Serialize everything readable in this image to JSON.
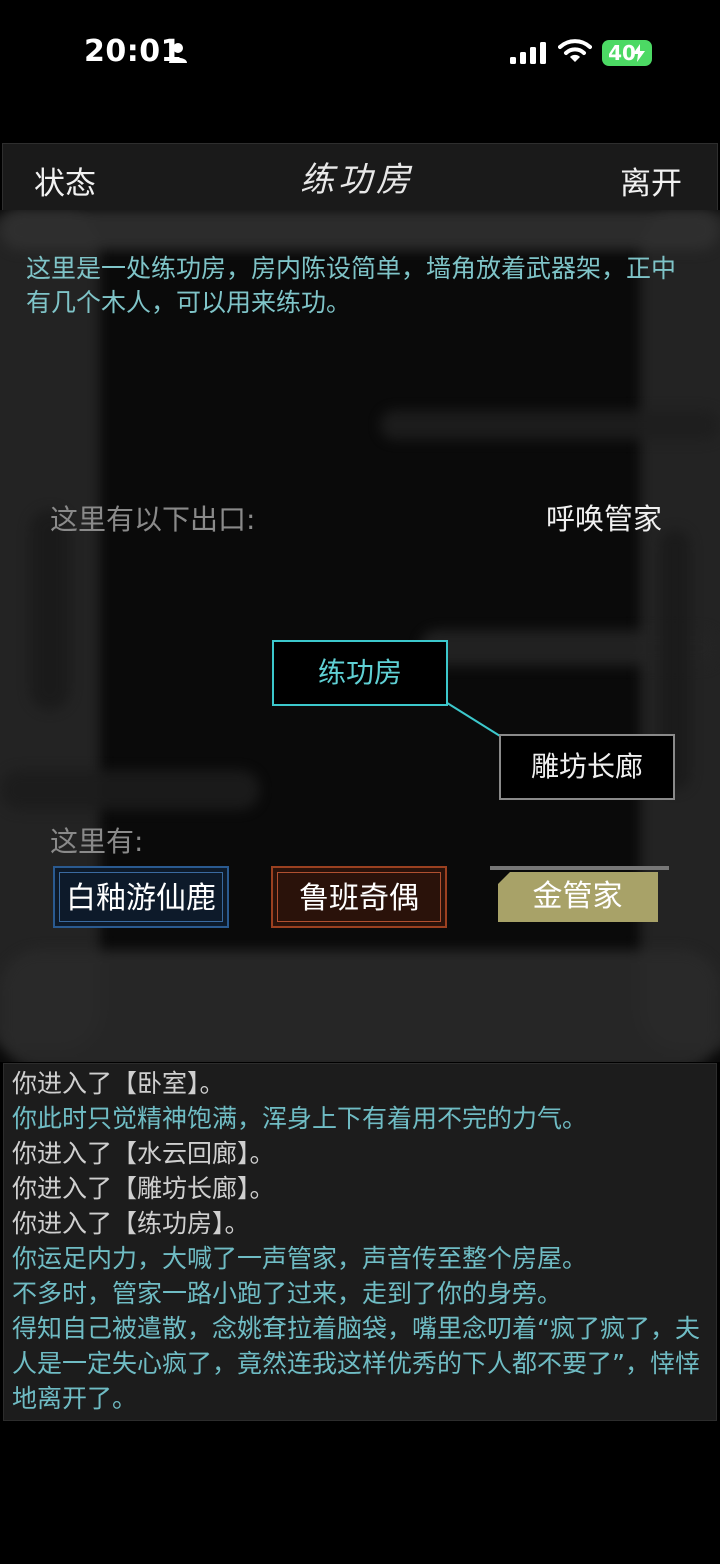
{
  "status_bar": {
    "time": "20:01",
    "battery": "40"
  },
  "header": {
    "left_button": "状态",
    "title": "练功房",
    "right_button": "离开"
  },
  "scene": {
    "description": "这里是一处练功房，房内陈设简单，墙角放着武器架，正中有几个木人，可以用来练功。",
    "exits_label": "这里有以下出口:",
    "summon_button": "呼唤管家",
    "map": {
      "current_room": "练功房",
      "exit_room": "雕坊长廊"
    },
    "here_label": "这里有:",
    "npcs": [
      {
        "name": "白釉游仙鹿",
        "color": "#2a5a90"
      },
      {
        "name": "鲁班奇偶",
        "color": "#9a4020"
      },
      {
        "name": "金管家",
        "color": "#a8a268"
      }
    ]
  },
  "log": [
    {
      "text": "你进入了【卧室】。",
      "color": "#cfcfcf"
    },
    {
      "text": "你此时只觉精神饱满，浑身上下有着用不完的力气。",
      "color": "#6fbcc4"
    },
    {
      "text": "你进入了【水云回廊】。",
      "color": "#cfcfcf"
    },
    {
      "text": "你进入了【雕坊长廊】。",
      "color": "#cfcfcf"
    },
    {
      "text": "你进入了【练功房】。",
      "color": "#cfcfcf"
    },
    {
      "text": "你运足内力，大喊了一声管家，声音传至整个房屋。",
      "color": "#6fbcc4"
    },
    {
      "text": "不多时，管家一路小跑了过来，走到了你的身旁。",
      "color": "#6fbcc4"
    },
    {
      "text": "得知自己被遣散，念姚耷拉着脑袋，嘴里念叨着“疯了疯了，夫人是一定失心疯了，竟然连我这样优秀的下人都不要了”，悻悻地离开了。",
      "color": "#6fbcc4"
    }
  ]
}
